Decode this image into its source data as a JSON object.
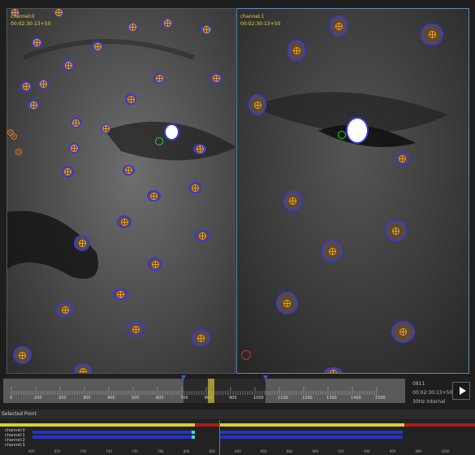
{
  "views": [
    {
      "channel": "channel:0",
      "timecode": "00:02:30:13+50"
    },
    {
      "channel": "channel:1",
      "timecode": "00:02:30:13+50"
    }
  ],
  "timeline": {
    "ticks": [
      "0",
      "100",
      "200",
      "300",
      "400",
      "500",
      "600",
      "700",
      "800",
      "900",
      "1000",
      "1100",
      "1200",
      "1300",
      "1400",
      "1500"
    ],
    "frame": "0811",
    "timecode": "00:02:30:13+50",
    "rate": "30Hz Internal"
  },
  "selected_point": {
    "title": "Selected Point",
    "channels": [
      "channel:0",
      "channel:1",
      "channel:2",
      "channel:3"
    ]
  },
  "bottom_ticks": [
    "600",
    "650",
    "700",
    "740",
    "750",
    "780",
    "800",
    "820",
    "840",
    "860",
    "880",
    "900",
    "920",
    "940",
    "960",
    "980",
    "1000"
  ],
  "colors": {
    "marker_ring": "#3a3ad8",
    "marker_cross": "#f0a020",
    "timecode": "#e6d33a",
    "track_yellow": "#d8d02a",
    "track_red": "#b01a1a",
    "track_blue": "#2233cc"
  }
}
